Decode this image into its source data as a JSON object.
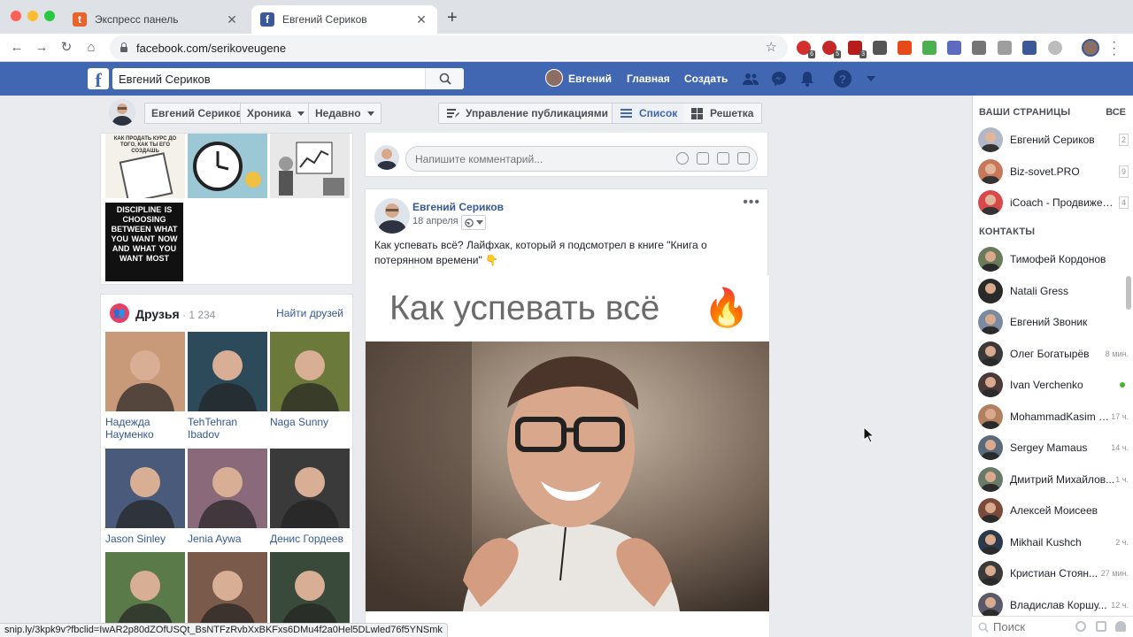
{
  "browser": {
    "tabs": [
      {
        "title": "Экспресс панель",
        "favicon_color": "#e8642a",
        "favicon_letter": "t",
        "active": false
      },
      {
        "title": "Евгений Сериков",
        "favicon_color": "#3b5998",
        "favicon_letter": "f",
        "active": true
      }
    ],
    "url": "facebook.com/serikoveugene",
    "extension_badges": [
      "6",
      "5",
      "3"
    ],
    "status_url": "snip.ly/3kpk9v?fbclid=IwAR2p80dZOfUSQt_BsNTFzRvbXxBKFxs6DMu4f2a0Hel5DLwled76f5YNSmk"
  },
  "fb_header": {
    "logo": "f",
    "search_value": "Евгений Сериков",
    "user_name": "Евгений",
    "home": "Главная",
    "create": "Создать",
    "brand_color": "#4267b2"
  },
  "timeline_nav": {
    "name": "Евгений Сериков",
    "chronicle": "Хроника",
    "recent": "Недавно",
    "manage": "Управление публикациями",
    "list": "Список",
    "grid": "Решетка"
  },
  "photos": [
    {
      "text": "КАК ПРОДАТЬ КУРС ДО ТОГО, КАК ТЫ ЕГО СОЗДАШЬ"
    },
    {
      "text": ""
    },
    {
      "text": ""
    },
    {
      "text": "DISCIPLINE IS CHOOSING BETWEEN WHAT YOU WANT NOW AND WHAT YOU WANT MOST"
    }
  ],
  "friends": {
    "title": "Друзья",
    "count": "· 1 234",
    "find": "Найти друзей",
    "items": [
      {
        "name": "Надежда Науменко",
        "color": "#c99a7a"
      },
      {
        "name": "TehTehran Ibadov",
        "color": "#2d4a5a"
      },
      {
        "name": "Naga Sunny",
        "color": "#6b7a3a"
      },
      {
        "name": "Jason Sinley",
        "color": "#4a5a7a"
      },
      {
        "name": "Jenia Aywa",
        "color": "#8a6a7a"
      },
      {
        "name": "Денис Гордеев",
        "color": "#3a3a3a"
      },
      {
        "name": "",
        "color": "#5a7a4a"
      },
      {
        "name": "",
        "color": "#7a5a4a"
      },
      {
        "name": "",
        "color": "#3a4a3a"
      }
    ]
  },
  "comment": {
    "placeholder": "Напишите комментарий..."
  },
  "post": {
    "author": "Евгений Сериков",
    "date": "18 апреля",
    "text": "Как успевать всё? Лайфхак, который я подсмотрел в книге \"Книга о потерянном времени\" 👇",
    "image_title": "Как успевать всё",
    "flame": "🔥",
    "more": "•••"
  },
  "sidebar": {
    "pages_header": "ВАШИ СТРАНИЦЫ",
    "all": "ВСЕ",
    "pages": [
      {
        "name": "Евгений Сериков",
        "count": "2",
        "color": "#b0b8c8"
      },
      {
        "name": "Biz-sovet.PRO",
        "count": "9",
        "color": "#c8785a"
      },
      {
        "name": "iCoach - Продвижени...",
        "count": "4",
        "color": "#d84a4a"
      }
    ],
    "contacts_header": "КОНТАКТЫ",
    "contacts": [
      {
        "name": "Тимофей Кордонов",
        "time": "",
        "online": false,
        "color": "#6a7a5a"
      },
      {
        "name": "Natali Gress",
        "time": "",
        "online": false,
        "color": "#2a2a2a"
      },
      {
        "name": "Евгений Звоник",
        "time": "",
        "online": false,
        "color": "#7a8aa0"
      },
      {
        "name": "Олег Богатырёв",
        "time": "8 мин.",
        "online": false,
        "color": "#3a3a3a"
      },
      {
        "name": "Ivan Verchenko",
        "time": "",
        "online": true,
        "color": "#4a3a3a"
      },
      {
        "name": "MohammadKasim S...",
        "time": "17 ч.",
        "online": false,
        "color": "#b08060"
      },
      {
        "name": "Sergey Mamaus",
        "time": "14 ч.",
        "online": false,
        "color": "#5a6a7a"
      },
      {
        "name": "Дмитрий Михайлов...",
        "time": "1 ч.",
        "online": false,
        "color": "#6a7a6a"
      },
      {
        "name": "Алексей Моисеев",
        "time": "",
        "online": false,
        "color": "#7a4a3a"
      },
      {
        "name": "Mikhail Kushch",
        "time": "2 ч.",
        "online": false,
        "color": "#2a3a4a"
      },
      {
        "name": "Кристиан Стоян...",
        "time": "27 мин.",
        "online": false,
        "color": "#3a3a3a"
      },
      {
        "name": "Владислав Коршу...",
        "time": "12 ч.",
        "online": false,
        "color": "#5a5a6a"
      }
    ],
    "search_placeholder": "Поиск"
  }
}
